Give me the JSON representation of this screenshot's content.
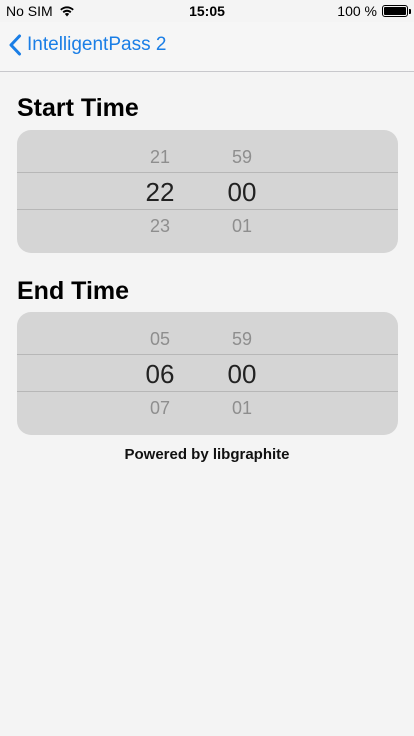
{
  "status_bar": {
    "carrier": "No SIM",
    "time": "15:05",
    "battery": "100 %",
    "wifi_icon": "wifi-icon",
    "battery_icon": "battery-icon",
    "battery_level": 1.0
  },
  "nav": {
    "back_label": "IntelligentPass 2",
    "back_icon": "chevron-left-icon",
    "accent": "#1a7ee6"
  },
  "start_time": {
    "title": "Start Time",
    "hours": {
      "prev": "21",
      "selected": "22",
      "next": "23"
    },
    "minutes": {
      "prev": "59",
      "selected": "00",
      "next": "01"
    }
  },
  "end_time": {
    "title": "End Time",
    "hours": {
      "prev": "05",
      "selected": "06",
      "next": "07"
    },
    "minutes": {
      "prev": "59",
      "selected": "00",
      "next": "01"
    }
  },
  "footer": {
    "text": "Powered by libgraphite"
  }
}
